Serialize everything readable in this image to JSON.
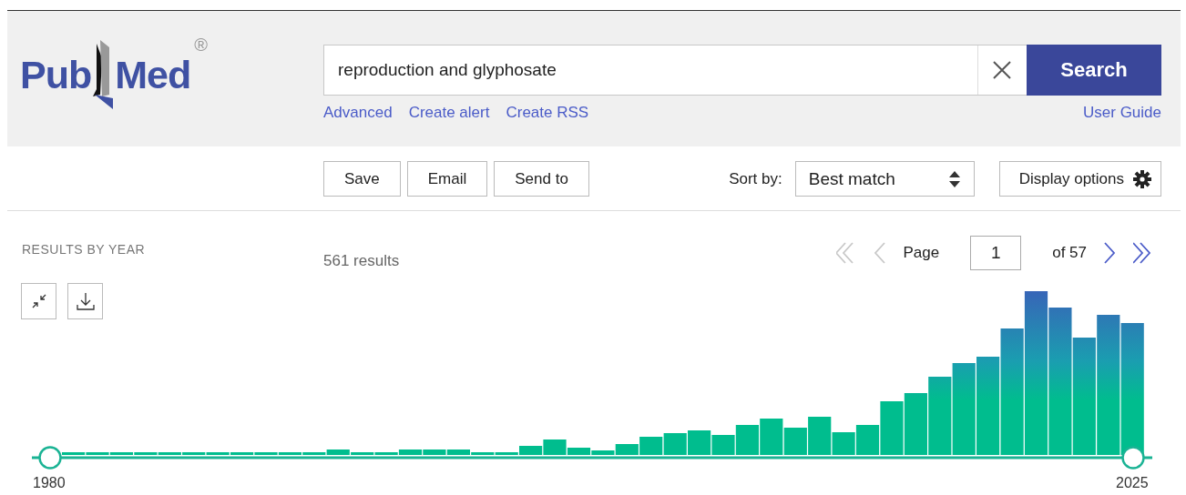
{
  "logo": {
    "parts": [
      "Pub",
      "Med"
    ],
    "registered": "®"
  },
  "search": {
    "value": "reproduction and glyphosate",
    "button": "Search"
  },
  "search_links": [
    "Advanced",
    "Create alert",
    "Create RSS"
  ],
  "user_guide": "User Guide",
  "actions": [
    "Save",
    "Email",
    "Send to"
  ],
  "sort": {
    "label": "Sort by:",
    "value": "Best match"
  },
  "display_options": "Display options",
  "results": {
    "heading": "RESULTS BY YEAR",
    "count": "561 results"
  },
  "pagination": {
    "page_label": "Page",
    "page": "1",
    "total": "of 57",
    "nav": [
      {
        "kind": "first",
        "disabled": true
      },
      {
        "kind": "prev",
        "disabled": true
      },
      {
        "kind": "next",
        "disabled": false
      },
      {
        "kind": "last",
        "disabled": false
      }
    ]
  },
  "year_range": {
    "start": "1980",
    "end": "2025"
  }
}
